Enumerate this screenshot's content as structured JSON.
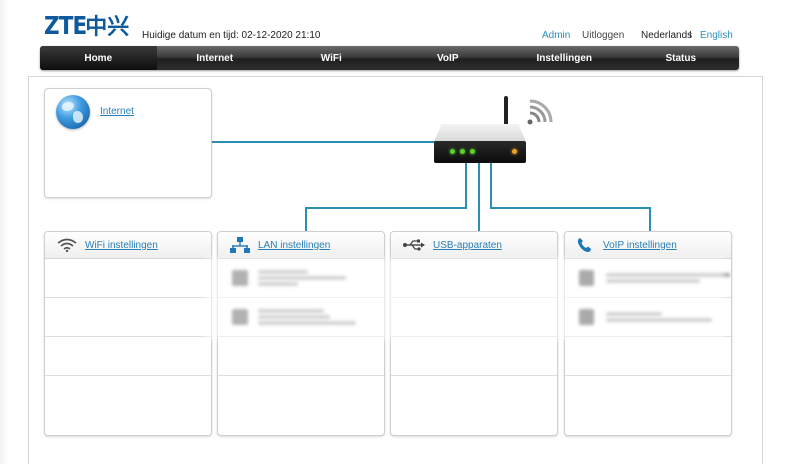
{
  "header": {
    "logo_text": "ZTE",
    "logo_cn": "中兴",
    "datetime": "Huidige datum en tijd: 02-12-2020 21:10",
    "links": {
      "admin": "Admin",
      "logout": "Uitloggen",
      "lang_nl": "Nederlands",
      "separator": "I",
      "lang_en": "English"
    }
  },
  "nav": {
    "items": [
      {
        "label": "Home",
        "active": true
      },
      {
        "label": "Internet",
        "active": false
      },
      {
        "label": "WiFi",
        "active": false
      },
      {
        "label": "VoIP",
        "active": false
      },
      {
        "label": "Instellingen",
        "active": false
      },
      {
        "label": "Status",
        "active": false
      }
    ]
  },
  "cards": {
    "internet": {
      "label": "Internet",
      "icon": "globe-icon"
    },
    "wifi": {
      "label": "WiFi instellingen",
      "icon": "wifi-icon"
    },
    "lan": {
      "label": "LAN instellingen",
      "icon": "network-icon"
    },
    "usb": {
      "label": "USB-apparaten",
      "icon": "usb-icon"
    },
    "voip": {
      "label": "VoIP instellingen",
      "icon": "phone-icon"
    }
  },
  "colors": {
    "accent": "#2a8fbd",
    "link": "#2a7fb6",
    "line": "#2c8fb1",
    "nav_bg": "#2e2e2e",
    "led_green": "#5bd12b",
    "led_orange": "#f0a020"
  }
}
